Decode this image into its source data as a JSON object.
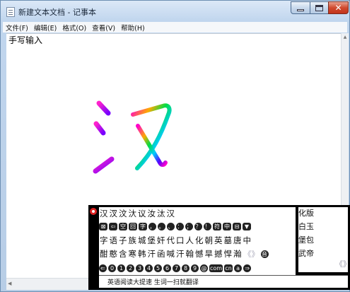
{
  "window": {
    "title": "新建文本文档 - 记事本"
  },
  "menu": [
    {
      "label": "文件(F)"
    },
    {
      "label": "编辑(E)"
    },
    {
      "label": "格式(O)"
    },
    {
      "label": "查看(V)"
    },
    {
      "label": "帮助(H)"
    }
  ],
  "editor": {
    "text": "手写输入"
  },
  "ime": {
    "candidates_row1": [
      "汉",
      "汊",
      "汶",
      "汏",
      "议",
      "汝",
      "汰",
      "汉"
    ],
    "symbols": [
      "⊠",
      "⇦",
      "空",
      "回",
      "字",
      "，",
      "。",
      "、",
      "：",
      "；",
      "？",
      "！",
      "符",
      "中",
      "⊟",
      "▼"
    ],
    "candidates_row3": [
      "字",
      "语",
      "子",
      "族",
      "城",
      "堡",
      "奸",
      "代",
      "口",
      "人",
      "化",
      "朝",
      "英",
      "墓",
      "唐",
      "中"
    ],
    "candidates_row4": [
      "酣",
      "憨",
      "含",
      "寒",
      "韩",
      "汗",
      "函",
      "喊",
      "汗",
      "翰",
      "憾",
      "旱",
      "撼",
      "悍",
      "瀚"
    ],
    "sound_key": "音",
    "number_keys": [
      "⇐",
      "0",
      "1",
      "2",
      "3",
      "4",
      "5",
      "6",
      "7",
      "8",
      "9",
      "@",
      "com",
      "cn",
      "a",
      "⇒"
    ],
    "page_prev": "《》",
    "right_words": [
      "化版",
      "白玉",
      "堡包",
      "武帝"
    ],
    "scroll_hint": "《》",
    "footer_text": "英语阅读大提速 生词一扫就翻译"
  }
}
